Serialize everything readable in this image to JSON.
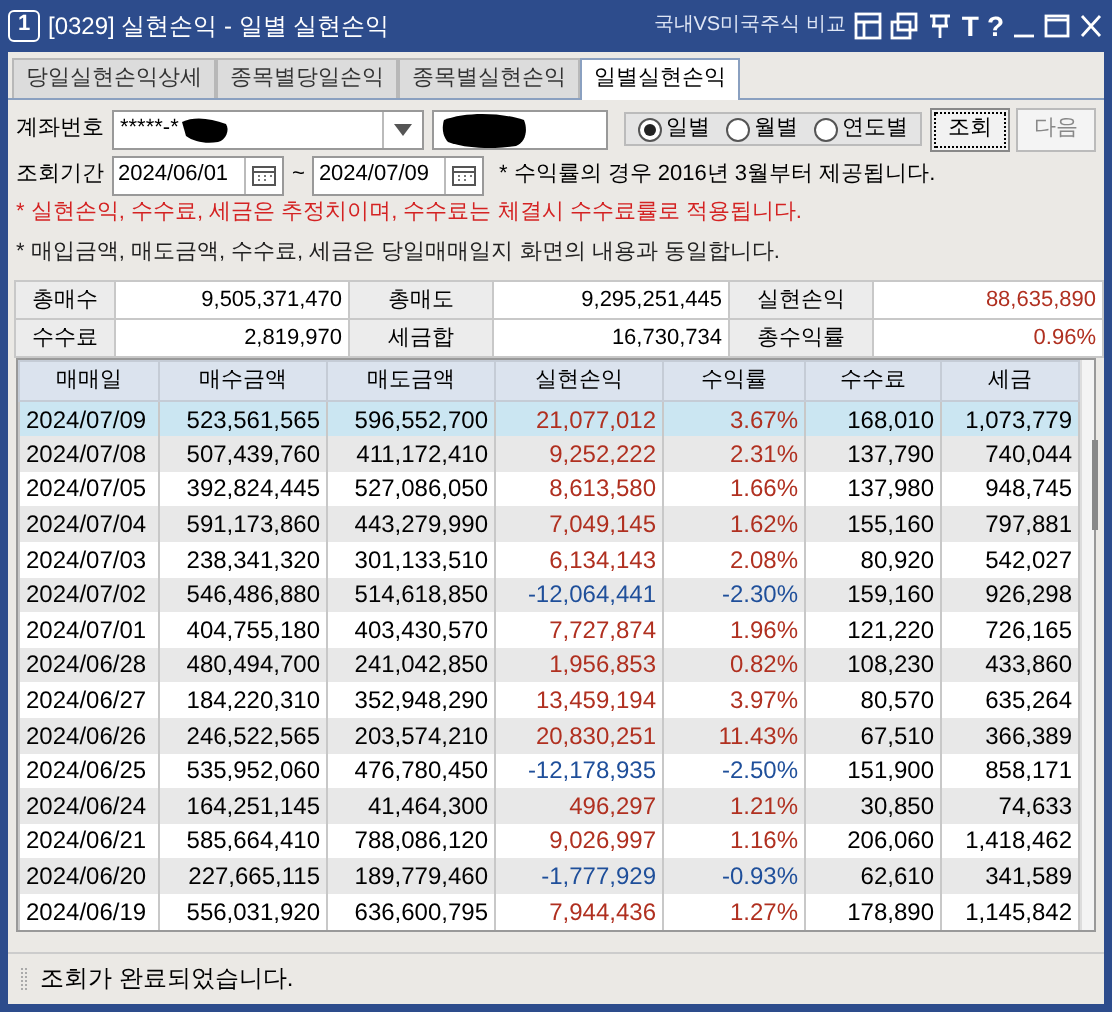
{
  "window": {
    "number": "1",
    "title": "[0329] 실현손익 - 일별 실현손익",
    "link": "국내VS미국주식 비교",
    "tool_chars": [
      "T",
      "?"
    ]
  },
  "tabs": [
    {
      "label": "당일실현손익상세",
      "selected": false
    },
    {
      "label": "종목별당일손익",
      "selected": false
    },
    {
      "label": "종목별실현손익",
      "selected": false
    },
    {
      "label": "일별실현손익",
      "selected": true
    }
  ],
  "form": {
    "account_label": "계좌번호",
    "account_value": "*****-*",
    "period_label": "조회기간",
    "date_from": "2024/06/01",
    "date_separator": "~",
    "date_to": "2024/07/09",
    "period_note": "* 수익률의 경우 2016년 3월부터 제공됩니다.",
    "modes": [
      {
        "label": "일별",
        "selected": true
      },
      {
        "label": "월별",
        "selected": false
      },
      {
        "label": "연도별",
        "selected": false
      }
    ],
    "buttons": [
      {
        "label": "조회",
        "disabled": false
      },
      {
        "label": "다음",
        "disabled": true
      }
    ],
    "notes": [
      {
        "text": "* 실현손익, 수수료, 세금은 추정치이며, 수수료는 체결시 수수료률로 적용됩니다.",
        "kind": "warning"
      },
      {
        "text": "* 매입금액, 매도금액, 수수료, 세금은 당일매매일지 화면의 내용과 동일합니다.",
        "kind": "info"
      }
    ]
  },
  "summary": [
    [
      {
        "label": "총매수",
        "value": "9,505,371,470"
      },
      {
        "label": "총매도",
        "value": "9,295,251,445"
      },
      {
        "label": "실현손익",
        "value": "88,635,890",
        "negative": false
      }
    ],
    [
      {
        "label": "수수료",
        "value": "2,819,970"
      },
      {
        "label": "세금합",
        "value": "16,730,734"
      },
      {
        "label": "총수익률",
        "value": "0.96%",
        "negative": false
      }
    ]
  ],
  "table": {
    "columns": [
      "매매일",
      "매수금액",
      "매도금액",
      "실현손익",
      "수익률",
      "수수료",
      "세금"
    ],
    "rows": [
      {
        "cells": [
          "2024/07/09",
          "523,561,565",
          "596,552,700",
          "21,077,012",
          "3.67%",
          "168,010",
          "1,073,779"
        ],
        "negative": false,
        "selected": true
      },
      {
        "cells": [
          "2024/07/08",
          "507,439,760",
          "411,172,410",
          "9,252,222",
          "2.31%",
          "137,790",
          "740,044"
        ],
        "negative": false,
        "selected": false
      },
      {
        "cells": [
          "2024/07/05",
          "392,824,445",
          "527,086,050",
          "8,613,580",
          "1.66%",
          "137,980",
          "948,745"
        ],
        "negative": false,
        "selected": false
      },
      {
        "cells": [
          "2024/07/04",
          "591,173,860",
          "443,279,990",
          "7,049,145",
          "1.62%",
          "155,160",
          "797,881"
        ],
        "negative": false,
        "selected": false
      },
      {
        "cells": [
          "2024/07/03",
          "238,341,320",
          "301,133,510",
          "6,134,143",
          "2.08%",
          "80,920",
          "542,027"
        ],
        "negative": false,
        "selected": false
      },
      {
        "cells": [
          "2024/07/02",
          "546,486,880",
          "514,618,850",
          "-12,064,441",
          "-2.30%",
          "159,160",
          "926,298"
        ],
        "negative": true,
        "selected": false
      },
      {
        "cells": [
          "2024/07/01",
          "404,755,180",
          "403,430,570",
          "7,727,874",
          "1.96%",
          "121,220",
          "726,165"
        ],
        "negative": false,
        "selected": false
      },
      {
        "cells": [
          "2024/06/28",
          "480,494,700",
          "241,042,850",
          "1,956,853",
          "0.82%",
          "108,230",
          "433,860"
        ],
        "negative": false,
        "selected": false
      },
      {
        "cells": [
          "2024/06/27",
          "184,220,310",
          "352,948,290",
          "13,459,194",
          "3.97%",
          "80,570",
          "635,264"
        ],
        "negative": false,
        "selected": false
      },
      {
        "cells": [
          "2024/06/26",
          "246,522,565",
          "203,574,210",
          "20,830,251",
          "11.43%",
          "67,510",
          "366,389"
        ],
        "negative": false,
        "selected": false
      },
      {
        "cells": [
          "2024/06/25",
          "535,952,060",
          "476,780,450",
          "-12,178,935",
          "-2.50%",
          "151,900",
          "858,171"
        ],
        "negative": true,
        "selected": false
      },
      {
        "cells": [
          "2024/06/24",
          "164,251,145",
          "41,464,300",
          "496,297",
          "1.21%",
          "30,850",
          "74,633"
        ],
        "negative": false,
        "selected": false
      },
      {
        "cells": [
          "2024/06/21",
          "585,664,410",
          "788,086,120",
          "9,026,997",
          "1.16%",
          "206,060",
          "1,418,462"
        ],
        "negative": false,
        "selected": false
      },
      {
        "cells": [
          "2024/06/20",
          "227,665,115",
          "189,779,460",
          "-1,777,929",
          "-0.93%",
          "62,610",
          "341,589"
        ],
        "negative": true,
        "selected": false
      },
      {
        "cells": [
          "2024/06/19",
          "556,031,920",
          "636,600,795",
          "7,944,436",
          "1.27%",
          "178,890",
          "1,145,842"
        ],
        "negative": false,
        "selected": false
      }
    ]
  },
  "status_bar": "조회가 완료되었습니다."
}
